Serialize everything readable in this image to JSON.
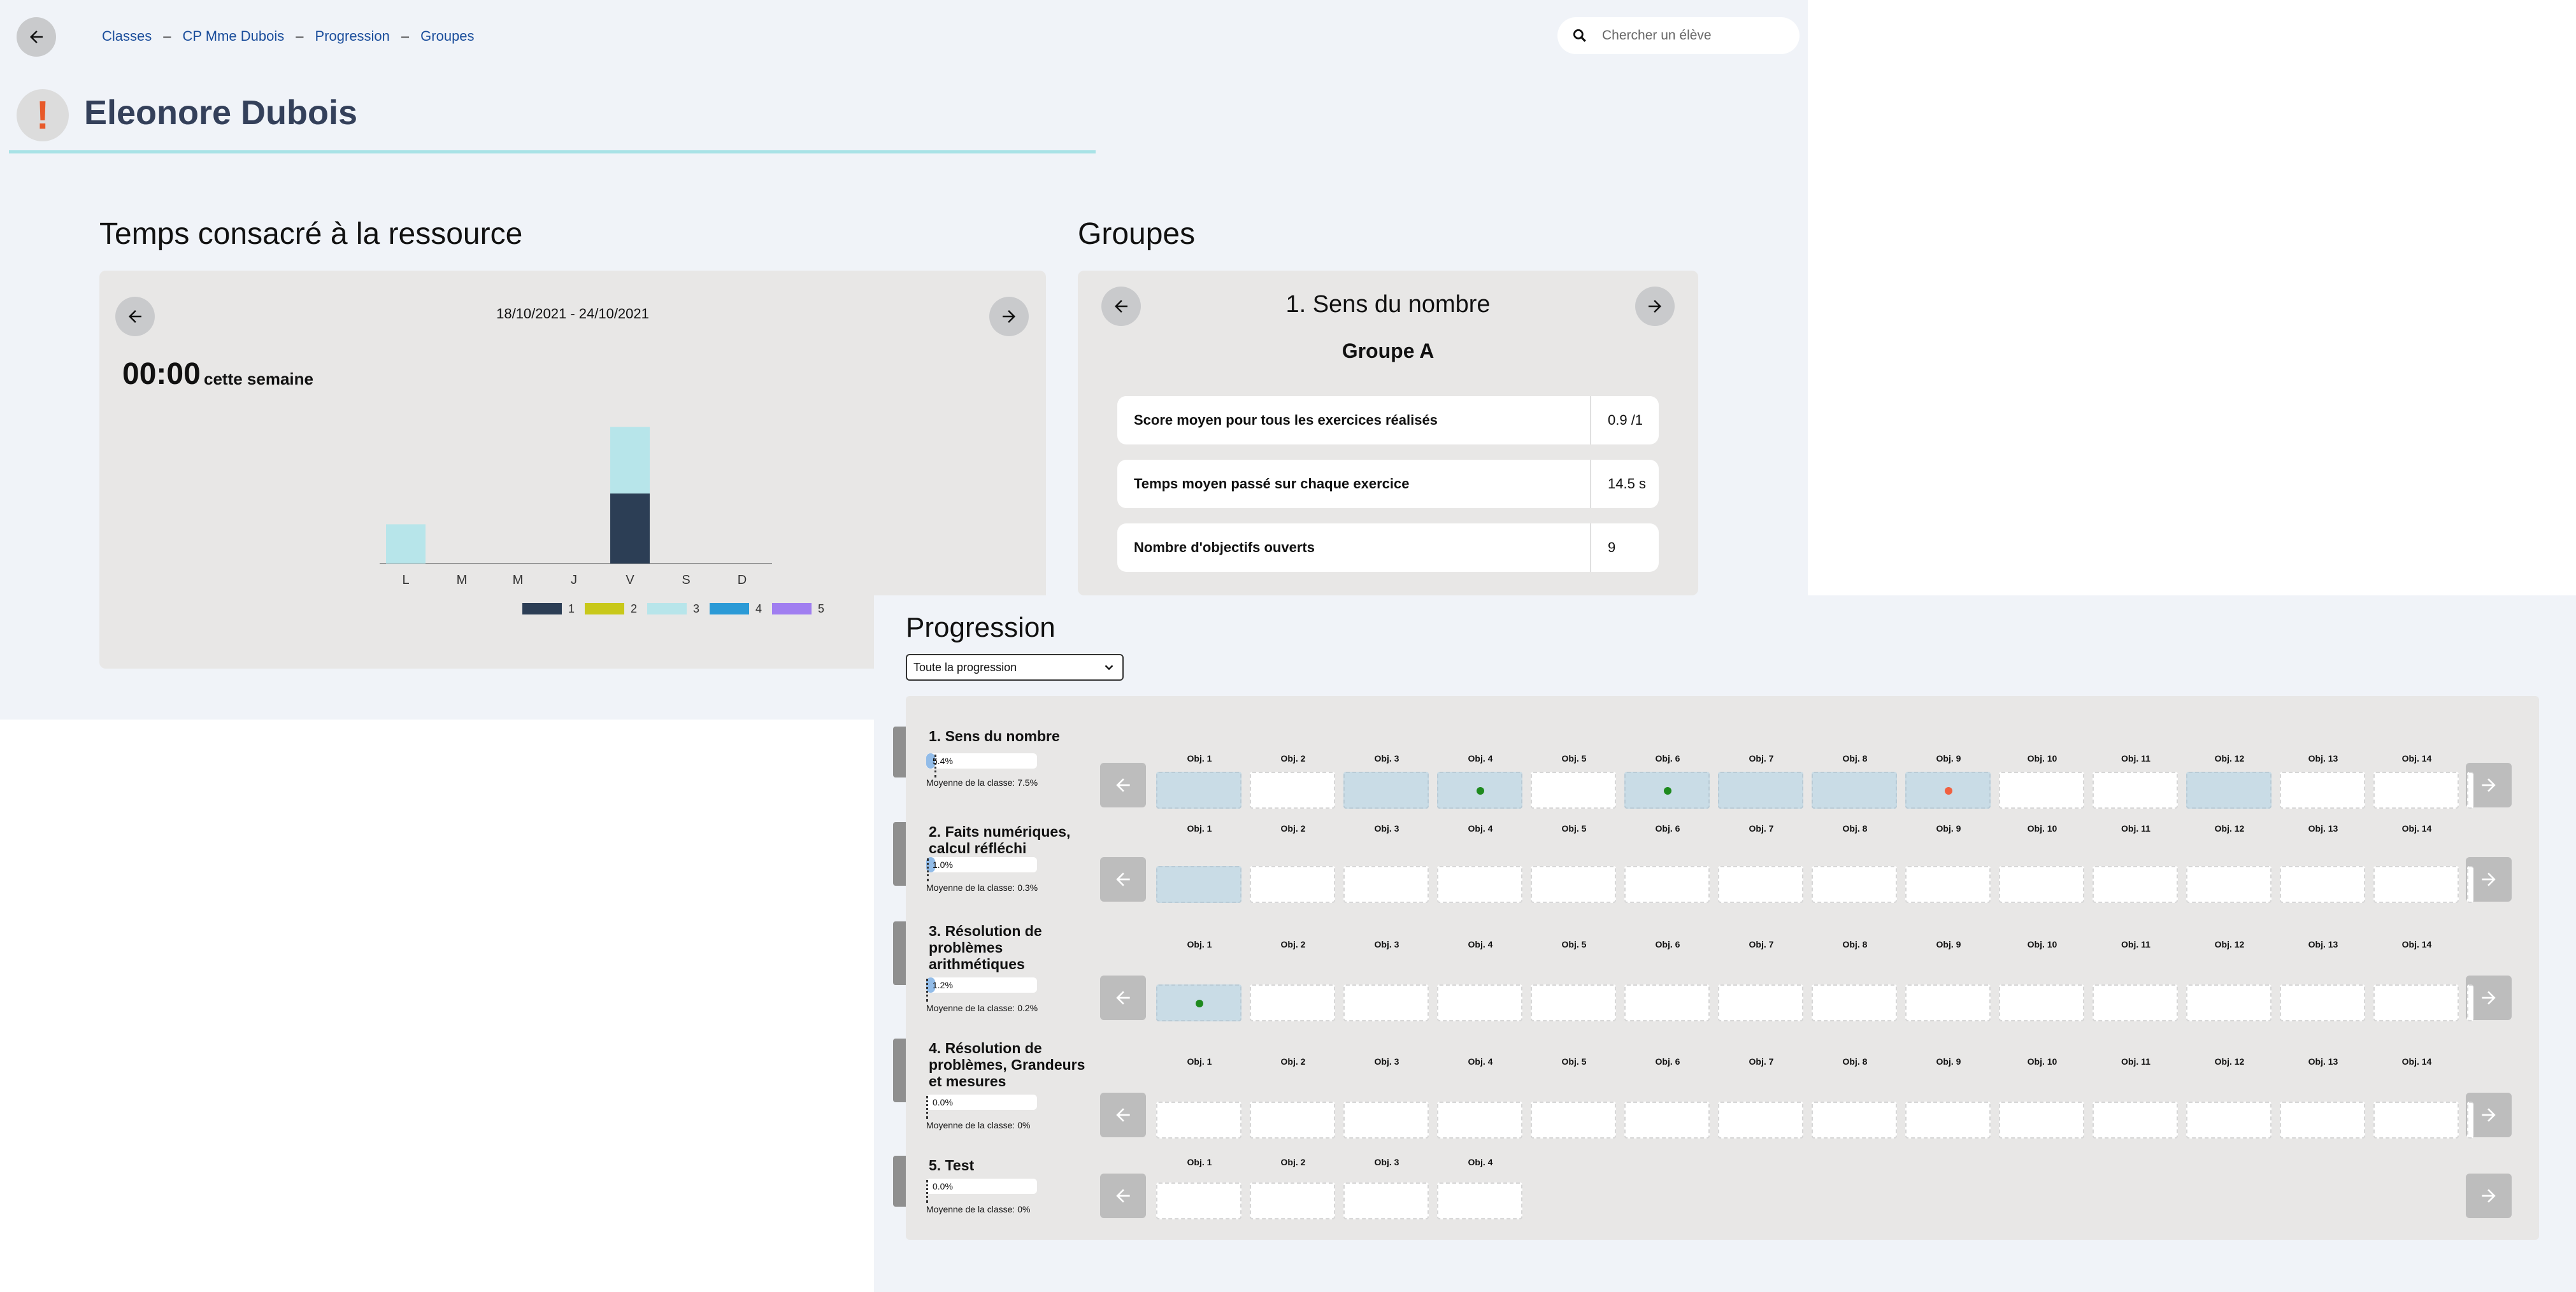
{
  "breadcrumb": [
    "Classes",
    "CP Mme Dubois",
    "Progression",
    "Groupes"
  ],
  "breadcrumb_separator": "–",
  "search": {
    "placeholder": "Chercher un élève"
  },
  "student": {
    "alert_symbol": "!",
    "name": "Eleonore Dubois"
  },
  "time_section": {
    "title": "Temps consacré à la ressource",
    "week_range": "18/10/2021 - 24/10/2021",
    "total": "00:00",
    "total_suffix": "cette semaine"
  },
  "chart_data": {
    "type": "bar",
    "stacked": true,
    "categories": [
      "L",
      "M",
      "M",
      "J",
      "V",
      "S",
      "D"
    ],
    "series": [
      {
        "name": "1",
        "color": "#2c3e55",
        "values": [
          0,
          0,
          0,
          0,
          1.0,
          0,
          0
        ]
      },
      {
        "name": "2",
        "color": "#c8c81a",
        "values": [
          0,
          0,
          0,
          0,
          0,
          0,
          0
        ]
      },
      {
        "name": "3",
        "color": "#b7e5ea",
        "values": [
          0.56,
          0,
          0,
          0,
          0.95,
          0,
          0
        ]
      },
      {
        "name": "4",
        "color": "#2b9ad6",
        "values": [
          0,
          0,
          0,
          0,
          0,
          0,
          0
        ]
      },
      {
        "name": "5",
        "color": "#a07ef0",
        "values": [
          0,
          0,
          0,
          0,
          0,
          0,
          0
        ]
      }
    ],
    "ylim": [
      0,
      2
    ],
    "legend": "bottom",
    "grid": false
  },
  "groups": {
    "title": "Groupes",
    "domain": "1. Sens du nombre",
    "group_name": "Groupe A",
    "stats": [
      {
        "label": "Score moyen pour tous les exercices réalisés",
        "value": "0.9 /1"
      },
      {
        "label": "Temps moyen passé sur chaque exercice",
        "value": "14.5 s"
      },
      {
        "label": "Nombre d'objectifs ouverts",
        "value": "9"
      }
    ]
  },
  "progression": {
    "title": "Progression",
    "select_value": "Toute la progression",
    "rows": [
      {
        "label": "1. Sens du nombre",
        "progress": "5.4%",
        "progress_value": 5.4,
        "class_avg": "Moyenne de la classe: 7.5%",
        "class_avg_value": 7.5,
        "objectives": [
          {
            "label": "Obj. 1",
            "done": true,
            "dot": null
          },
          {
            "label": "Obj. 2",
            "done": false,
            "dot": null
          },
          {
            "label": "Obj. 3",
            "done": true,
            "dot": null
          },
          {
            "label": "Obj. 4",
            "done": true,
            "dot": "#1e8a1e"
          },
          {
            "label": "Obj. 5",
            "done": false,
            "dot": null
          },
          {
            "label": "Obj. 6",
            "done": true,
            "dot": "#1e8a1e"
          },
          {
            "label": "Obj. 7",
            "done": true,
            "dot": null
          },
          {
            "label": "Obj. 8",
            "done": true,
            "dot": null
          },
          {
            "label": "Obj. 9",
            "done": true,
            "dot": "#f06040"
          },
          {
            "label": "Obj. 10",
            "done": false,
            "dot": null
          },
          {
            "label": "Obj. 11",
            "done": false,
            "dot": null
          },
          {
            "label": "Obj. 12",
            "done": true,
            "dot": null
          },
          {
            "label": "Obj. 13",
            "done": false,
            "dot": null
          },
          {
            "label": "Obj. 14",
            "done": false,
            "dot": null
          }
        ],
        "more": true
      },
      {
        "label": "2. Faits numériques, calcul réfléchi",
        "progress": "1.0%",
        "progress_value": 1.0,
        "class_avg": "Moyenne de la classe: 0.3%",
        "class_avg_value": 0.3,
        "objectives": [
          {
            "label": "Obj. 1",
            "done": true,
            "dot": null
          },
          {
            "label": "Obj. 2",
            "done": false,
            "dot": null
          },
          {
            "label": "Obj. 3",
            "done": false,
            "dot": null
          },
          {
            "label": "Obj. 4",
            "done": false,
            "dot": null
          },
          {
            "label": "Obj. 5",
            "done": false,
            "dot": null
          },
          {
            "label": "Obj. 6",
            "done": false,
            "dot": null
          },
          {
            "label": "Obj. 7",
            "done": false,
            "dot": null
          },
          {
            "label": "Obj. 8",
            "done": false,
            "dot": null
          },
          {
            "label": "Obj. 9",
            "done": false,
            "dot": null
          },
          {
            "label": "Obj. 10",
            "done": false,
            "dot": null
          },
          {
            "label": "Obj. 11",
            "done": false,
            "dot": null
          },
          {
            "label": "Obj. 12",
            "done": false,
            "dot": null
          },
          {
            "label": "Obj. 13",
            "done": false,
            "dot": null
          },
          {
            "label": "Obj. 14",
            "done": false,
            "dot": null
          }
        ],
        "more": true
      },
      {
        "label": "3. Résolution de problèmes arithmétiques",
        "progress": "1.2%",
        "progress_value": 1.2,
        "class_avg": "Moyenne de la classe: 0.2%",
        "class_avg_value": 0.2,
        "objectives": [
          {
            "label": "Obj. 1",
            "done": true,
            "dot": "#1e8a1e"
          },
          {
            "label": "Obj. 2",
            "done": false,
            "dot": null
          },
          {
            "label": "Obj. 3",
            "done": false,
            "dot": null
          },
          {
            "label": "Obj. 4",
            "done": false,
            "dot": null
          },
          {
            "label": "Obj. 5",
            "done": false,
            "dot": null
          },
          {
            "label": "Obj. 6",
            "done": false,
            "dot": null
          },
          {
            "label": "Obj. 7",
            "done": false,
            "dot": null
          },
          {
            "label": "Obj. 8",
            "done": false,
            "dot": null
          },
          {
            "label": "Obj. 9",
            "done": false,
            "dot": null
          },
          {
            "label": "Obj. 10",
            "done": false,
            "dot": null
          },
          {
            "label": "Obj. 11",
            "done": false,
            "dot": null
          },
          {
            "label": "Obj. 12",
            "done": false,
            "dot": null
          },
          {
            "label": "Obj. 13",
            "done": false,
            "dot": null
          },
          {
            "label": "Obj. 14",
            "done": false,
            "dot": null
          }
        ],
        "more": true
      },
      {
        "label": "4. Résolution de problèmes, Grandeurs et mesures",
        "progress": "0.0%",
        "progress_value": 0.0,
        "class_avg": "Moyenne de la classe: 0%",
        "class_avg_value": 0,
        "objectives": [
          {
            "label": "Obj. 1",
            "done": false,
            "dot": null
          },
          {
            "label": "Obj. 2",
            "done": false,
            "dot": null
          },
          {
            "label": "Obj. 3",
            "done": false,
            "dot": null
          },
          {
            "label": "Obj. 4",
            "done": false,
            "dot": null
          },
          {
            "label": "Obj. 5",
            "done": false,
            "dot": null
          },
          {
            "label": "Obj. 6",
            "done": false,
            "dot": null
          },
          {
            "label": "Obj. 7",
            "done": false,
            "dot": null
          },
          {
            "label": "Obj. 8",
            "done": false,
            "dot": null
          },
          {
            "label": "Obj. 9",
            "done": false,
            "dot": null
          },
          {
            "label": "Obj. 10",
            "done": false,
            "dot": null
          },
          {
            "label": "Obj. 11",
            "done": false,
            "dot": null
          },
          {
            "label": "Obj. 12",
            "done": false,
            "dot": null
          },
          {
            "label": "Obj. 13",
            "done": false,
            "dot": null
          },
          {
            "label": "Obj. 14",
            "done": false,
            "dot": null
          }
        ],
        "more": true
      },
      {
        "label": "5. Test",
        "progress": "0.0%",
        "progress_value": 0.0,
        "class_avg": "Moyenne de la classe: 0%",
        "class_avg_value": 0,
        "objectives": [
          {
            "label": "Obj. 1",
            "done": false,
            "dot": null
          },
          {
            "label": "Obj. 2",
            "done": false,
            "dot": null
          },
          {
            "label": "Obj. 3",
            "done": false,
            "dot": null
          },
          {
            "label": "Obj. 4",
            "done": false,
            "dot": null
          }
        ],
        "more": false
      }
    ]
  },
  "icons": {
    "back": "arrow-left-icon",
    "next": "arrow-right-icon",
    "search": "search-icon",
    "dropdown": "chevron-down-icon"
  }
}
